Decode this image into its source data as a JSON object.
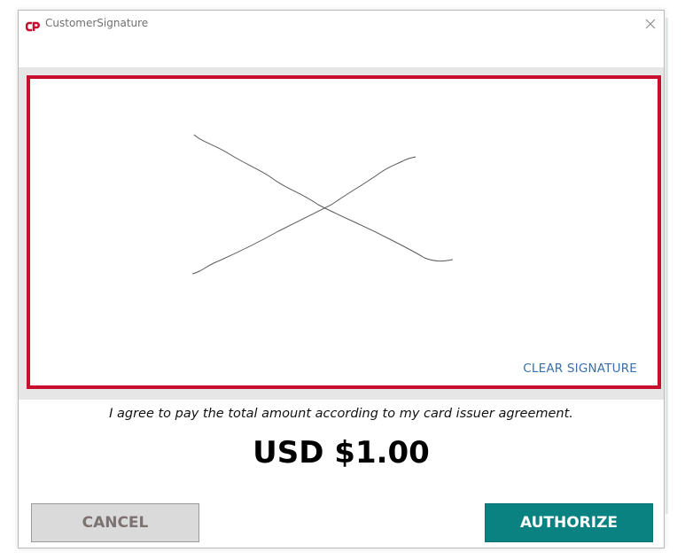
{
  "window": {
    "title": "CustomerSignature"
  },
  "signature": {
    "clear_label": "CLEAR SIGNATURE",
    "border_color": "#c8102e"
  },
  "agreement_text": "I agree to pay the total amount according to my card issuer agreement.",
  "amount_text": "USD $1.00",
  "buttons": {
    "cancel_label": "CANCEL",
    "authorize_label": "AUTHORIZE"
  },
  "colors": {
    "brand_red": "#c8102e",
    "authorize_teal": "#0a8281",
    "link_blue": "#3a6fa8"
  },
  "icons": {
    "app_logo": "cardpointe-logo-icon",
    "close": "close-icon"
  }
}
